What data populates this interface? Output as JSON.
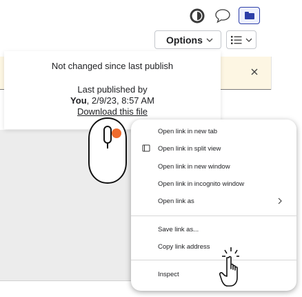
{
  "toolbar": {
    "options_label": "Options"
  },
  "publish_card": {
    "status": "Not changed since last publish",
    "last_published_label": "Last published by",
    "publisher": "You",
    "publish_date": ", 2/9/23, 8:57 AM",
    "download_link": "Download this file"
  },
  "context_menu": {
    "items": [
      "Open link in new tab",
      "Open link in split view",
      "Open link in new window",
      "Open link in incognito window",
      "Open link as",
      "Save link as...",
      "Copy link address",
      "Inspect"
    ]
  },
  "colors": {
    "accent": "#2d3fa8",
    "banner_bg": "#fdf6e3",
    "mouse_accent": "#ee6b2d"
  }
}
